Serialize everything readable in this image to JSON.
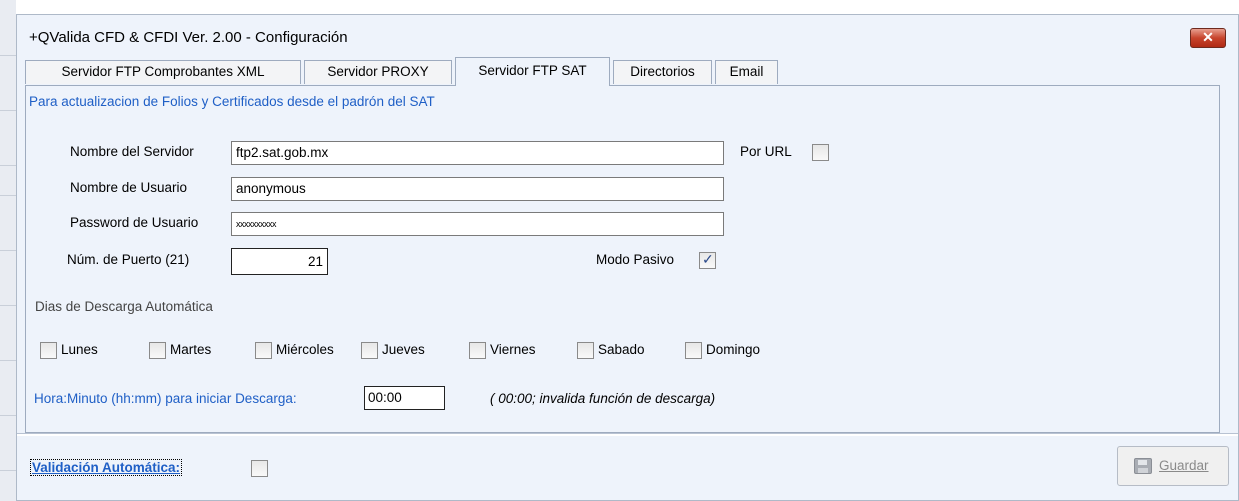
{
  "window": {
    "title": "+QValida CFD & CFDI Ver. 2.00 - Configuración",
    "close_glyph": "✕"
  },
  "tabs": [
    {
      "label": "Servidor  FTP Comprobantes XML",
      "active": false
    },
    {
      "label": "Servidor PROXY",
      "active": false
    },
    {
      "label": "Servidor FTP SAT",
      "active": true
    },
    {
      "label": "Directorios",
      "active": false
    },
    {
      "label": "Email",
      "active": false
    }
  ],
  "panel": {
    "heading": "Para actualizacion de Folios y Certificados desde el padrón del SAT",
    "server_name": {
      "label": "Nombre del Servidor",
      "value": "ftp2.sat.gob.mx"
    },
    "por_url": {
      "label": "Por URL",
      "checked": false
    },
    "user_name": {
      "label": "Nombre de Usuario",
      "value": "anonymous"
    },
    "password": {
      "label": "Password de Usuario",
      "value": "xxxxxxxxxx"
    },
    "port": {
      "label": "Núm. de Puerto (21)",
      "value": "21"
    },
    "passive_mode": {
      "label": "Modo Pasivo",
      "checked": true
    },
    "days_heading": "Dias de Descarga Automática",
    "days": [
      {
        "label": "Lunes",
        "checked": false
      },
      {
        "label": "Martes",
        "checked": false
      },
      {
        "label": "Miércoles",
        "checked": false
      },
      {
        "label": "Jueves",
        "checked": false
      },
      {
        "label": "Viernes",
        "checked": false
      },
      {
        "label": "Sabado",
        "checked": false
      },
      {
        "label": "Domingo",
        "checked": false
      }
    ],
    "time": {
      "label": "Hora:Minuto (hh:mm) para iniciar Descarga:",
      "value": "00:00",
      "hint": "( 00:00; invalida función de descarga)"
    }
  },
  "footer": {
    "auto_validation": {
      "label": "Validación Automática:",
      "checked": false
    },
    "save_label": "Guardar"
  },
  "colors": {
    "accent_link": "#1f5fc6",
    "window_bg": "#eef3fb",
    "close_red": "#c7442c"
  },
  "icons": {
    "close": "close-icon",
    "save": "floppy-disk-icon",
    "check": "checkmark-icon"
  }
}
